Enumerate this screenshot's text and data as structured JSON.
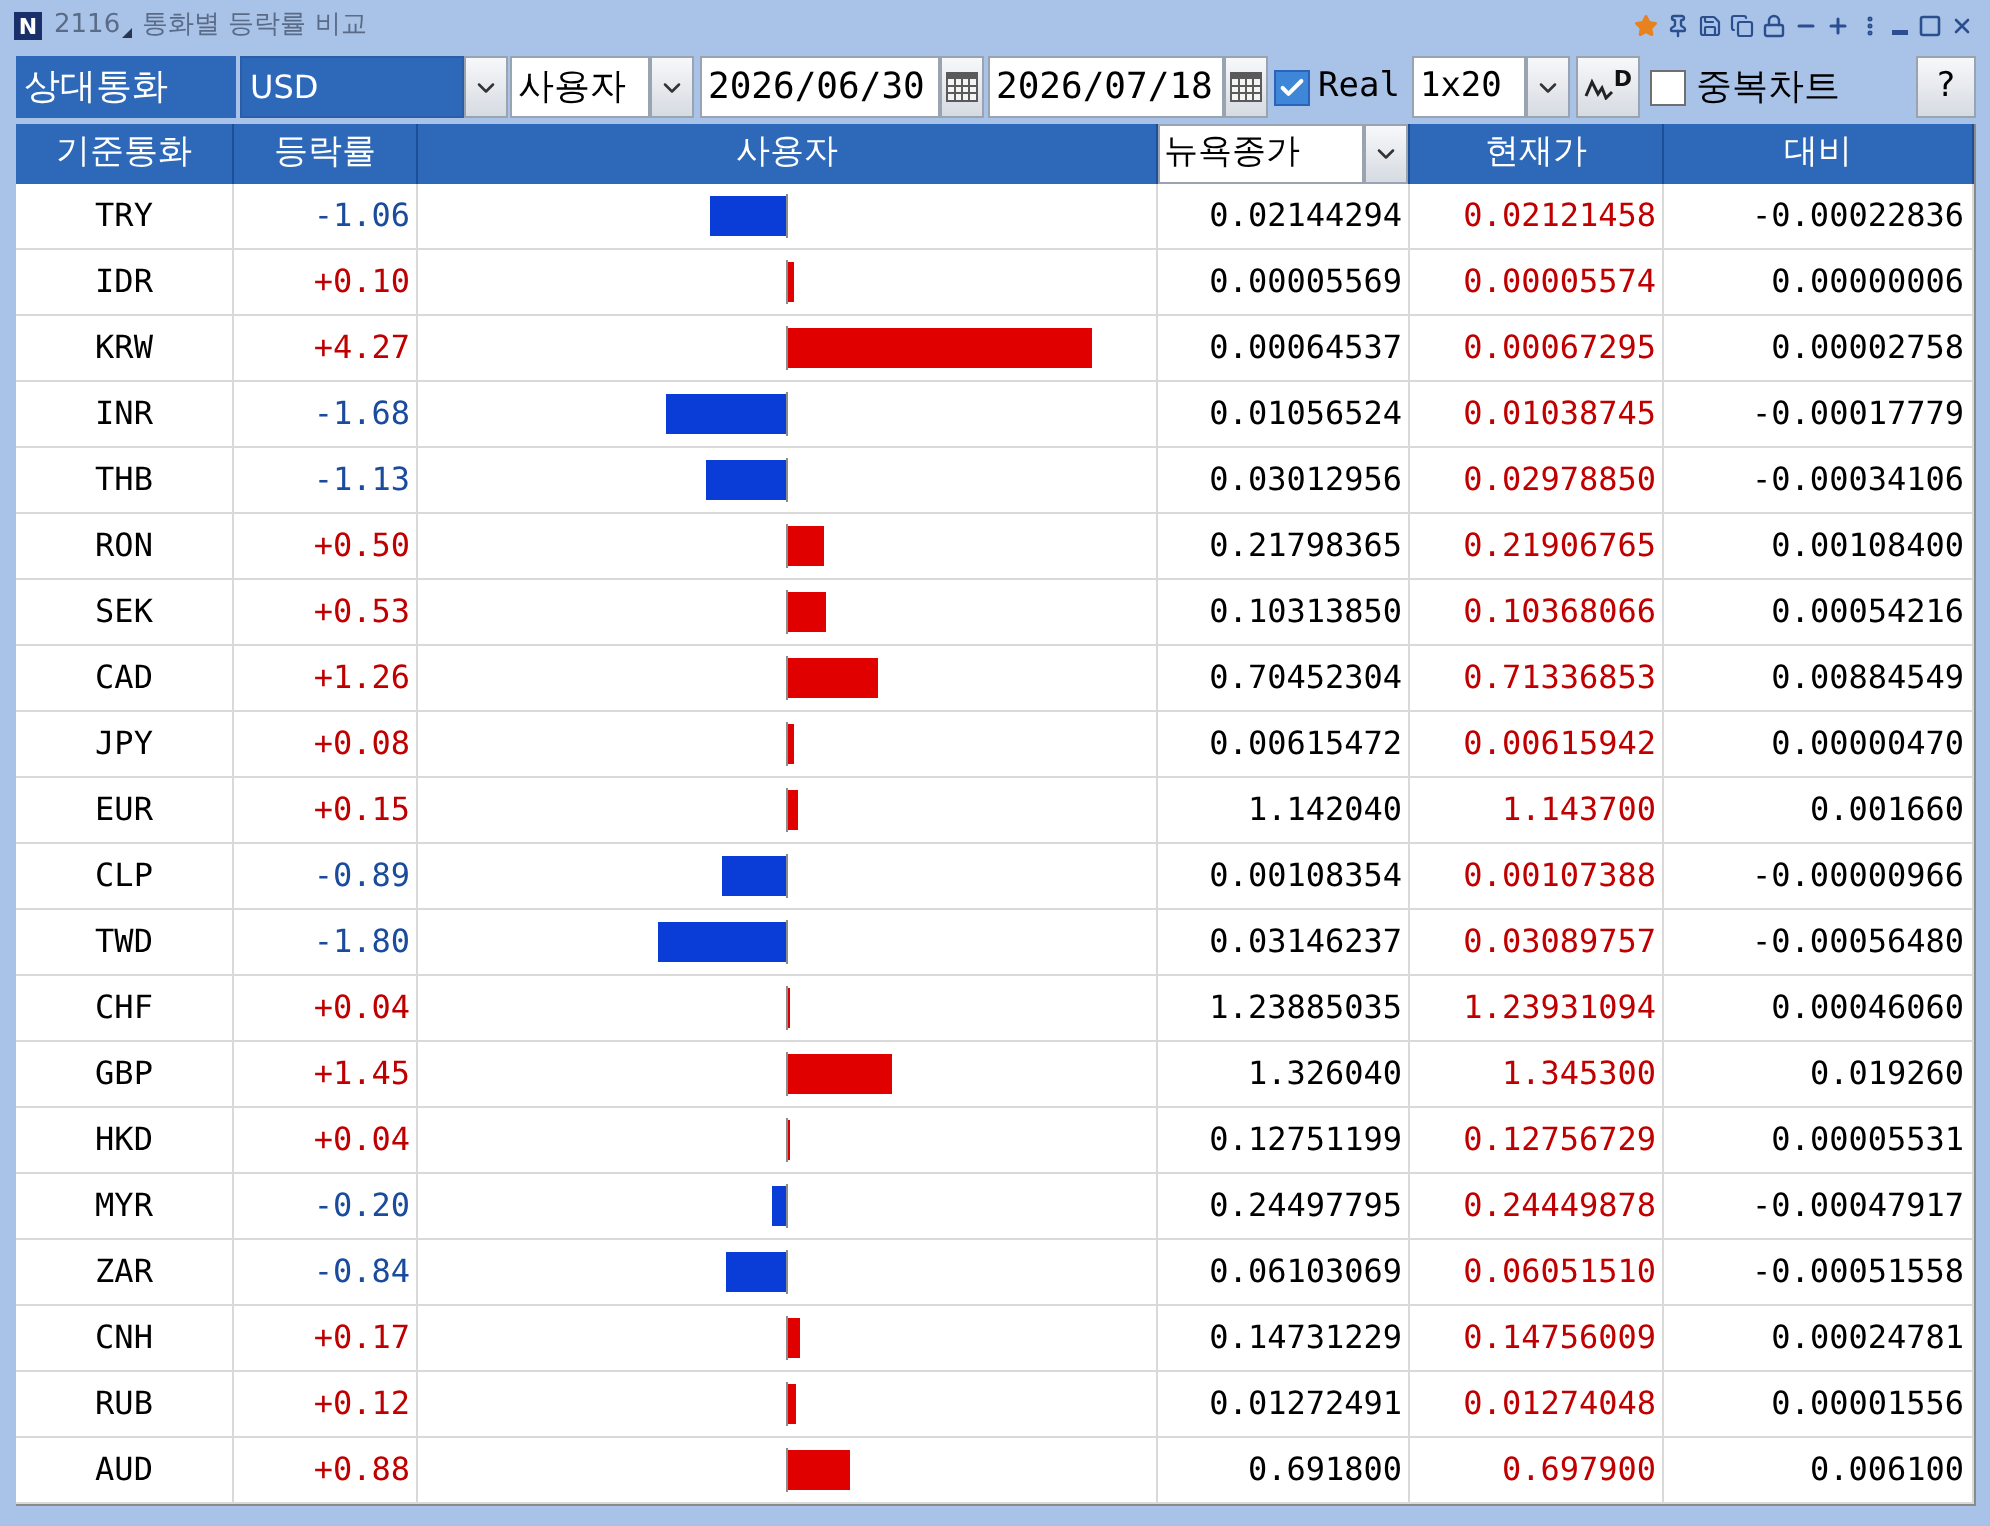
{
  "window": {
    "logo_letter": "N",
    "screen_number": "2116",
    "title": "통화별 등락률 비교"
  },
  "toolbar": {
    "counter_currency_label": "상대통화",
    "counter_currency": "USD",
    "mode": "사용자",
    "start_date": "2026/06/30",
    "end_date": "2026/07/18",
    "real": {
      "label": "Real",
      "checked": true
    },
    "interval": "1x20",
    "chart_button_letter": "D",
    "overlay_chart": {
      "label": "중복차트",
      "checked": false
    },
    "help": "?"
  },
  "table": {
    "columns": [
      {
        "label": "기준통화",
        "kind": "header"
      },
      {
        "label": "등락률",
        "kind": "header"
      },
      {
        "label": "사용자",
        "kind": "header"
      },
      {
        "label": "뉴욕종가",
        "kind": "dropdown"
      },
      {
        "label": "현재가",
        "kind": "header"
      },
      {
        "label": "대비",
        "kind": "header"
      }
    ],
    "rows": [
      {
        "currency": "TRY",
        "change": "-1.06",
        "rising": false,
        "level": 0.205,
        "ny_close": "0.02144294",
        "current": "0.02121458",
        "diff": "-0.00022836"
      },
      {
        "currency": "IDR",
        "change": "+0.10",
        "rising": true,
        "level": 0.019,
        "ny_close": "0.00005569",
        "current": "0.00005574",
        "diff": "0.00000006"
      },
      {
        "currency": "KRW",
        "change": "+4.27",
        "rising": true,
        "level": 0.826,
        "ny_close": "0.00064537",
        "current": "0.00067295",
        "diff": "0.00002758"
      },
      {
        "currency": "INR",
        "change": "-1.68",
        "rising": false,
        "level": 0.325,
        "ny_close": "0.01056524",
        "current": "0.01038745",
        "diff": "-0.00017779"
      },
      {
        "currency": "THB",
        "change": "-1.13",
        "rising": false,
        "level": 0.219,
        "ny_close": "0.03012956",
        "current": "0.02978850",
        "diff": "-0.00034106"
      },
      {
        "currency": "RON",
        "change": "+0.50",
        "rising": true,
        "level": 0.097,
        "ny_close": "0.21798365",
        "current": "0.21906765",
        "diff": "0.00108400"
      },
      {
        "currency": "SEK",
        "change": "+0.53",
        "rising": true,
        "level": 0.103,
        "ny_close": "0.10313850",
        "current": "0.10368066",
        "diff": "0.00054216"
      },
      {
        "currency": "CAD",
        "change": "+1.26",
        "rising": true,
        "level": 0.244,
        "ny_close": "0.70452304",
        "current": "0.71336853",
        "diff": "0.00884549"
      },
      {
        "currency": "JPY",
        "change": "+0.08",
        "rising": true,
        "level": 0.015,
        "ny_close": "0.00615472",
        "current": "0.00615942",
        "diff": "0.00000470"
      },
      {
        "currency": "EUR",
        "change": "+0.15",
        "rising": true,
        "level": 0.029,
        "ny_close": "1.142040",
        "current": "1.143700",
        "diff": "0.001660"
      },
      {
        "currency": "CLP",
        "change": "-0.89",
        "rising": false,
        "level": 0.172,
        "ny_close": "0.00108354",
        "current": "0.00107388",
        "diff": "-0.00000966"
      },
      {
        "currency": "TWD",
        "change": "-1.80",
        "rising": false,
        "level": 0.348,
        "ny_close": "0.03146237",
        "current": "0.03089757",
        "diff": "-0.00056480"
      },
      {
        "currency": "CHF",
        "change": "+0.04",
        "rising": true,
        "level": 0.008,
        "ny_close": "1.23885035",
        "current": "1.23931094",
        "diff": "0.00046060"
      },
      {
        "currency": "GBP",
        "change": "+1.45",
        "rising": true,
        "level": 0.281,
        "ny_close": "1.326040",
        "current": "1.345300",
        "diff": "0.019260"
      },
      {
        "currency": "HKD",
        "change": "+0.04",
        "rising": true,
        "level": 0.008,
        "ny_close": "0.12751199",
        "current": "0.12756729",
        "diff": "0.00005531"
      },
      {
        "currency": "MYR",
        "change": "-0.20",
        "rising": false,
        "level": 0.039,
        "ny_close": "0.24497795",
        "current": "0.24449878",
        "diff": "-0.00047917"
      },
      {
        "currency": "ZAR",
        "change": "-0.84",
        "rising": false,
        "level": 0.163,
        "ny_close": "0.06103069",
        "current": "0.06051510",
        "diff": "-0.00051558"
      },
      {
        "currency": "CNH",
        "change": "+0.17",
        "rising": true,
        "level": 0.033,
        "ny_close": "0.14731229",
        "current": "0.14756009",
        "diff": "0.00024781"
      },
      {
        "currency": "RUB",
        "change": "+0.12",
        "rising": true,
        "level": 0.023,
        "ny_close": "0.01272491",
        "current": "0.01274048",
        "diff": "0.00001556"
      },
      {
        "currency": "AUD",
        "change": "+0.88",
        "rising": true,
        "level": 0.17,
        "ny_close": "0.691800",
        "current": "0.697900",
        "diff": "0.006100"
      }
    ]
  }
}
